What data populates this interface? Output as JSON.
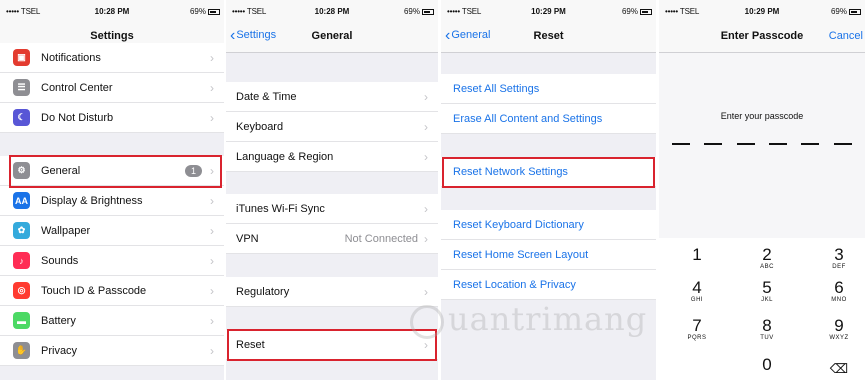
{
  "status": {
    "carrier": "••••• TSEL",
    "battery": "69%"
  },
  "panel1": {
    "time": "10:28 PM",
    "title": "Settings",
    "items": [
      {
        "label": "Notifications",
        "icon": "notifications-icon",
        "color": "#e33b2f"
      },
      {
        "label": "Control Center",
        "icon": "control-center-icon",
        "color": "#8e8e93"
      },
      {
        "label": "Do Not Disturb",
        "icon": "moon-icon",
        "color": "#5856d6"
      },
      {
        "label": "General",
        "icon": "gear-icon",
        "color": "#8e8e93",
        "badge": "1"
      },
      {
        "label": "Display & Brightness",
        "icon": "display-icon",
        "color": "#1a73e8"
      },
      {
        "label": "Wallpaper",
        "icon": "wallpaper-icon",
        "color": "#34aadc"
      },
      {
        "label": "Sounds",
        "icon": "sounds-icon",
        "color": "#ff2d55"
      },
      {
        "label": "Touch ID & Passcode",
        "icon": "fingerprint-icon",
        "color": "#ff3b30"
      },
      {
        "label": "Battery",
        "icon": "battery-icon",
        "color": "#4cd964"
      },
      {
        "label": "Privacy",
        "icon": "hand-icon",
        "color": "#8e8e93"
      }
    ]
  },
  "panel2": {
    "time": "10:28 PM",
    "back": "Settings",
    "title": "General",
    "items": [
      {
        "label": "Date & Time"
      },
      {
        "label": "Keyboard"
      },
      {
        "label": "Language & Region"
      },
      {
        "label": "iTunes Wi-Fi Sync"
      },
      {
        "label": "VPN",
        "value": "Not Connected"
      },
      {
        "label": "Regulatory"
      },
      {
        "label": "Reset"
      }
    ]
  },
  "panel3": {
    "time": "10:29 PM",
    "back": "General",
    "title": "Reset",
    "items": [
      {
        "label": "Reset All Settings"
      },
      {
        "label": "Erase All Content and Settings"
      },
      {
        "label": "Reset Network Settings"
      },
      {
        "label": "Reset Keyboard Dictionary"
      },
      {
        "label": "Reset Home Screen Layout"
      },
      {
        "label": "Reset Location & Privacy"
      }
    ]
  },
  "panel4": {
    "time": "10:29 PM",
    "title": "Enter Passcode",
    "cancel": "Cancel",
    "prompt": "Enter your passcode",
    "keys": [
      {
        "num": "1",
        "letters": ""
      },
      {
        "num": "2",
        "letters": "ABC"
      },
      {
        "num": "3",
        "letters": "DEF"
      },
      {
        "num": "4",
        "letters": "GHI"
      },
      {
        "num": "5",
        "letters": "JKL"
      },
      {
        "num": "6",
        "letters": "MNO"
      },
      {
        "num": "7",
        "letters": "PQRS"
      },
      {
        "num": "8",
        "letters": "TUV"
      },
      {
        "num": "9",
        "letters": "WXYZ"
      },
      {
        "num": "0",
        "letters": ""
      }
    ]
  },
  "watermark": "uantrimang",
  "colors": {
    "accent": "#1a73e8",
    "highlight": "#d9232e"
  }
}
